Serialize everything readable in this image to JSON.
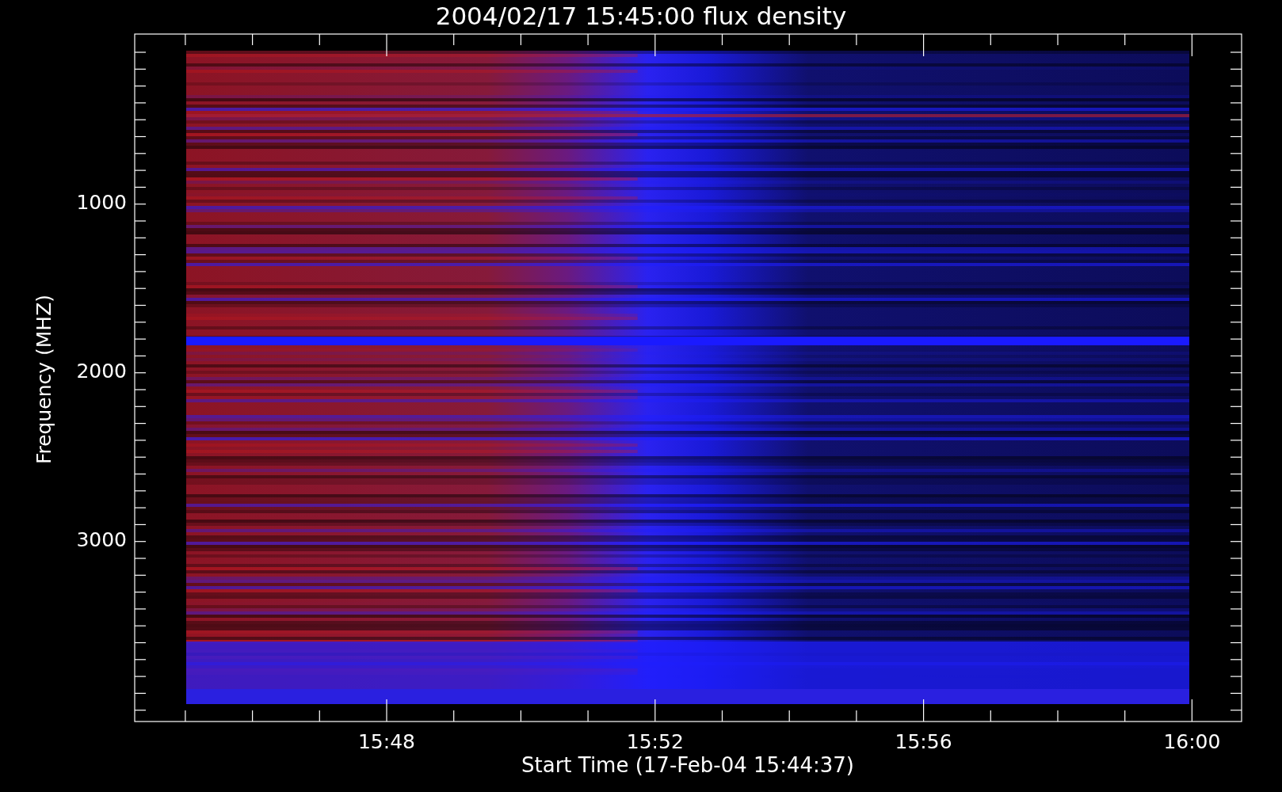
{
  "title": "2004/02/17 15:45:00 flux density",
  "y_axis": {
    "label": "Frequency (MHZ)",
    "ticks": [
      "1000",
      "2000",
      "3000"
    ]
  },
  "x_axis": {
    "label": "Start Time (17-Feb-04 15:44:37)",
    "ticks": [
      "15:48",
      "15:52",
      "15:56",
      "16:00"
    ]
  }
}
